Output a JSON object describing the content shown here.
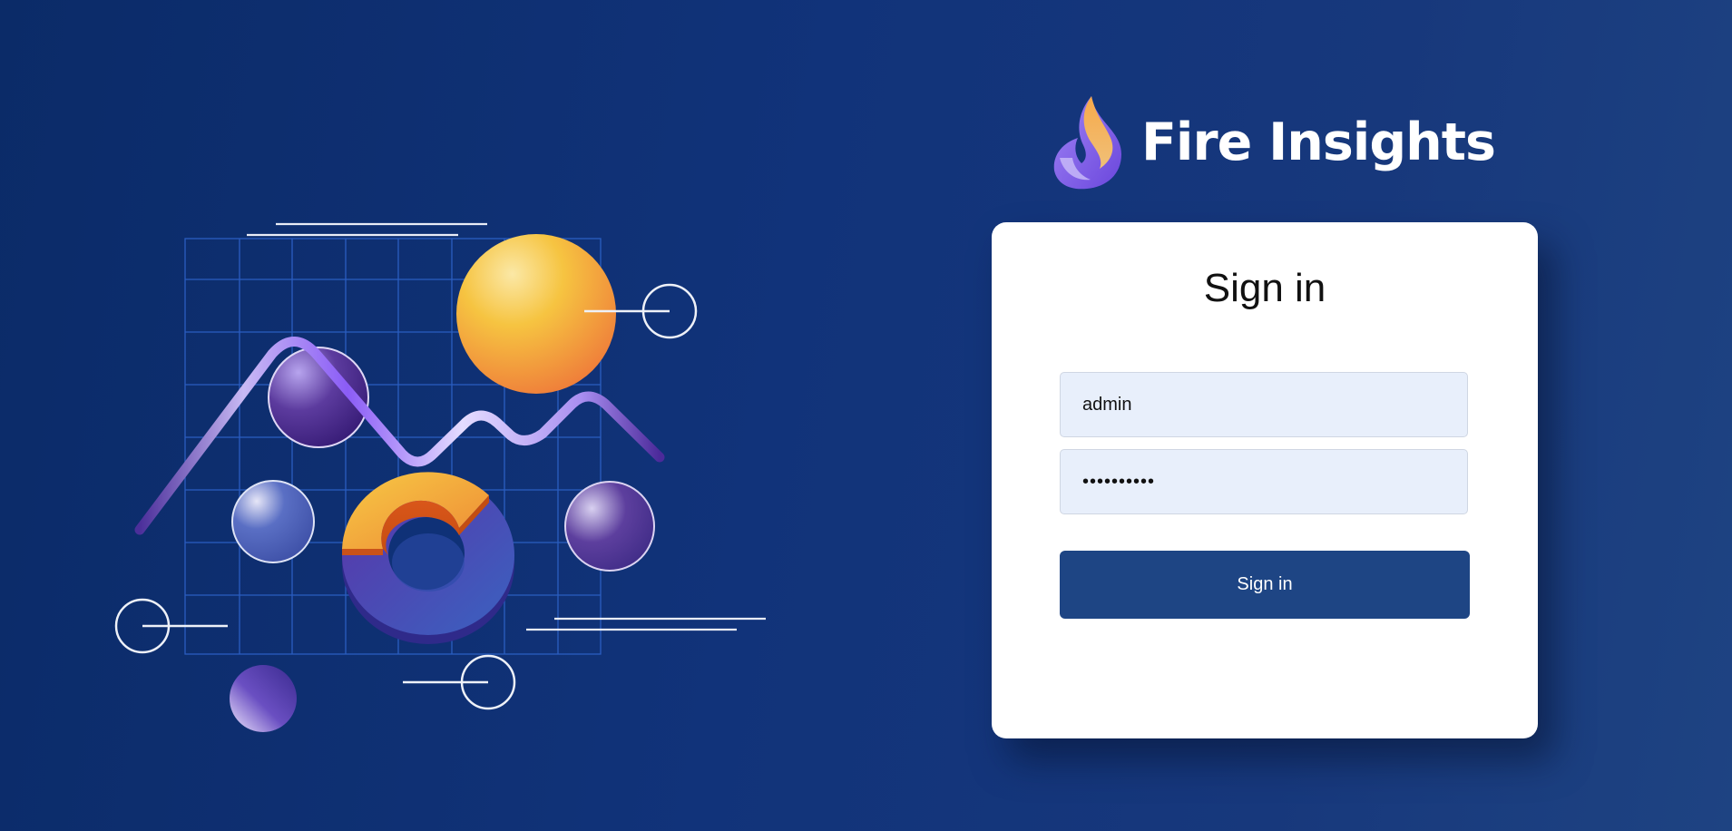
{
  "brand": {
    "name": "Fire Insights",
    "logo_icon": "flame-logo-icon"
  },
  "login": {
    "title": "Sign in",
    "username_value": "admin",
    "password_value": "••••••••••",
    "submit_label": "Sign in"
  },
  "colors": {
    "background": "#0b2b68",
    "card": "#ffffff",
    "button": "#1e4584",
    "input_fill": "#e8effb",
    "accent_orange": "#f5b53f",
    "accent_purple": "#7b5cf0"
  }
}
